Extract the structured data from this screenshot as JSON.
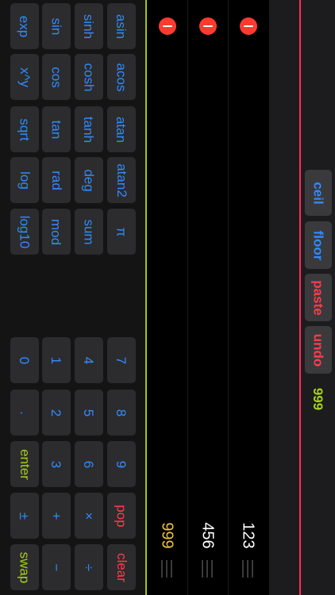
{
  "keypad": {
    "function_keys": [
      {
        "id": "exp",
        "label": "exp",
        "color": "blue"
      },
      {
        "id": "sinh",
        "label": "sinh",
        "color": "blue"
      },
      {
        "id": "asin",
        "label": "asin",
        "color": "blue"
      },
      {
        "id": "x-pow-y",
        "label": "x^y",
        "color": "blue"
      },
      {
        "id": "cosh",
        "label": "cosh",
        "color": "blue"
      },
      {
        "id": "acos",
        "label": "acos",
        "color": "blue"
      },
      {
        "id": "sqrt",
        "label": "sqrt",
        "color": "blue"
      },
      {
        "id": "tanh",
        "label": "tanh",
        "color": "blue"
      },
      {
        "id": "atan",
        "label": "atan",
        "color": "blue"
      },
      {
        "id": "log",
        "label": "log",
        "color": "blue"
      },
      {
        "id": "deg",
        "label": "deg",
        "color": "blue"
      },
      {
        "id": "atan2",
        "label": "atan2",
        "color": "blue"
      },
      {
        "id": "log10",
        "label": "log10",
        "color": "blue"
      },
      {
        "id": "sum",
        "label": "sum",
        "color": "blue"
      },
      {
        "id": "pi",
        "label": "π",
        "color": "blue"
      },
      {
        "id": "sin",
        "label": "sin",
        "color": "blue"
      },
      {
        "id": "cos",
        "label": "cos",
        "color": "blue"
      },
      {
        "id": "tan",
        "label": "tan",
        "color": "blue"
      },
      {
        "id": "rad",
        "label": "rad",
        "color": "blue"
      },
      {
        "id": "mod",
        "label": "mod",
        "color": "blue"
      }
    ],
    "number_keys": [
      {
        "id": "0",
        "label": "0",
        "color": "blue"
      },
      {
        "id": "dot",
        "label": ".",
        "color": "blue"
      },
      {
        "id": "1",
        "label": "1",
        "color": "blue"
      },
      {
        "id": "2",
        "label": "2",
        "color": "blue"
      },
      {
        "id": "3",
        "label": "3",
        "color": "blue"
      },
      {
        "id": "4",
        "label": "4",
        "color": "blue"
      },
      {
        "id": "5",
        "label": "5",
        "color": "blue"
      },
      {
        "id": "6",
        "label": "6",
        "color": "blue"
      },
      {
        "id": "7",
        "label": "7",
        "color": "blue"
      },
      {
        "id": "8",
        "label": "8",
        "color": "blue"
      },
      {
        "id": "9",
        "label": "9",
        "color": "blue"
      },
      {
        "id": "enter",
        "label": "enter",
        "color": "green"
      },
      {
        "id": "plus-minus",
        "label": "±",
        "color": "blue"
      },
      {
        "id": "swap",
        "label": "swap",
        "color": "green"
      },
      {
        "id": "plus",
        "label": "+",
        "color": "blue"
      },
      {
        "id": "minus",
        "label": "−",
        "color": "blue"
      },
      {
        "id": "times",
        "label": "×",
        "color": "blue"
      },
      {
        "id": "divide",
        "label": "÷",
        "color": "blue"
      },
      {
        "id": "pop",
        "label": "pop",
        "color": "red"
      },
      {
        "id": "clear",
        "label": "clear",
        "color": "red"
      }
    ]
  },
  "stack": {
    "items": [
      {
        "value": "999",
        "color": "#f0c040"
      },
      {
        "value": "456",
        "color": "#ffffff"
      },
      {
        "value": "123",
        "color": "#ffffff"
      }
    ]
  },
  "sidebar": {
    "buttons": [
      {
        "id": "ceil",
        "label": "ceil",
        "color": "blue"
      },
      {
        "id": "floor",
        "label": "floor",
        "color": "blue"
      },
      {
        "id": "paste",
        "label": "paste",
        "color": "red"
      },
      {
        "id": "undo",
        "label": "undo",
        "color": "red"
      }
    ],
    "x_value": "999"
  },
  "colors": {
    "accent_green": "#a8c21c",
    "accent_red": "#ff2d55",
    "key_blue": "#2f8bff"
  }
}
